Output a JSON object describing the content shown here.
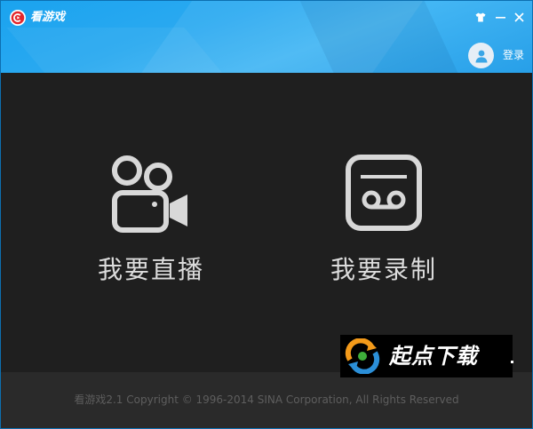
{
  "window": {
    "title": "看游戏",
    "accent": "#1ca2ee",
    "skin_icon": "tshirt-icon",
    "minimize_icon": "minimize-icon",
    "close_icon": "close-icon"
  },
  "account": {
    "avatar_icon": "user-icon",
    "login_label": "登录"
  },
  "features": [
    {
      "icon": "video-camera-icon",
      "label": "我要直播"
    },
    {
      "icon": "cassette-tape-icon",
      "label": "我要录制"
    }
  ],
  "footer": {
    "copyright": "看游戏2.1 Copyright © 1996-2014 SINA Corporation, All Rights Reserved"
  },
  "watermark": {
    "text": "起点下载"
  }
}
